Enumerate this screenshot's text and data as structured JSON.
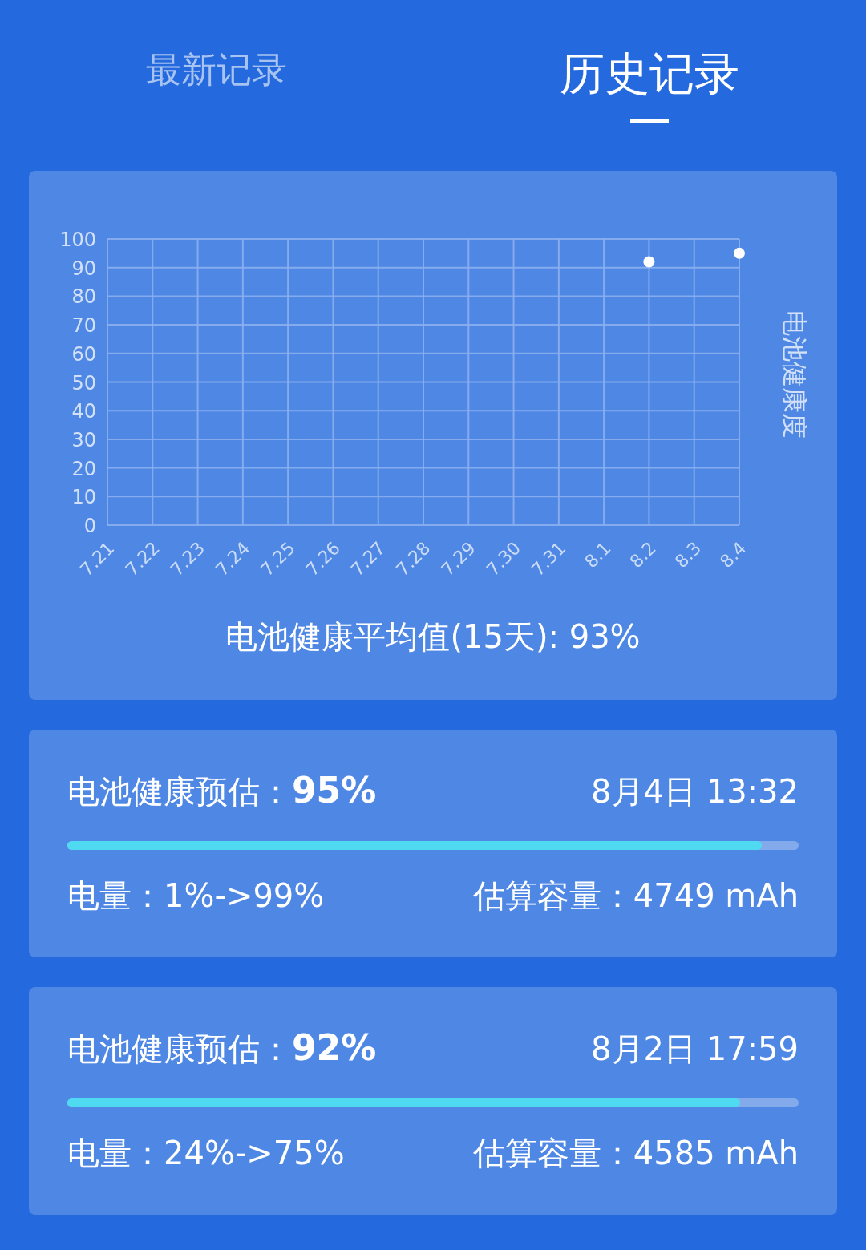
{
  "tabs": [
    {
      "label": "最新记录",
      "selected": false
    },
    {
      "label": "历史记录",
      "selected": true
    }
  ],
  "chart_card": {
    "chart_data": {
      "type": "scatter",
      "ylabel": "电池健康度",
      "categories": [
        "7.21",
        "7.22",
        "7.23",
        "7.24",
        "7.25",
        "7.26",
        "7.27",
        "7.28",
        "7.29",
        "7.30",
        "7.31",
        "8.1",
        "8.2",
        "8.3",
        "8.4"
      ],
      "grid": true,
      "series": [
        {
          "color": "#ffffff",
          "values": [
            null,
            null,
            null,
            null,
            null,
            null,
            null,
            null,
            null,
            null,
            null,
            null,
            92,
            null,
            95
          ]
        }
      ],
      "ylim": [
        0,
        100
      ],
      "yticks": [
        0,
        10,
        20,
        30,
        40,
        50,
        60,
        70,
        80,
        90,
        100
      ]
    },
    "average": "电池健康平均值(15天): 93%"
  },
  "records": [
    {
      "estimate": "电池健康预估：**95%**",
      "time": "8月4日 13:32",
      "level": 0.95,
      "charge": "电量：1%->99%",
      "capacity": "估算容量：4749 mAh"
    },
    {
      "estimate": "电池健康预估：**92%**",
      "time": "8月2日 17:59",
      "level": 0.92,
      "charge": "电量：24%->75%",
      "capacity": "估算容量：4585 mAh"
    }
  ]
}
